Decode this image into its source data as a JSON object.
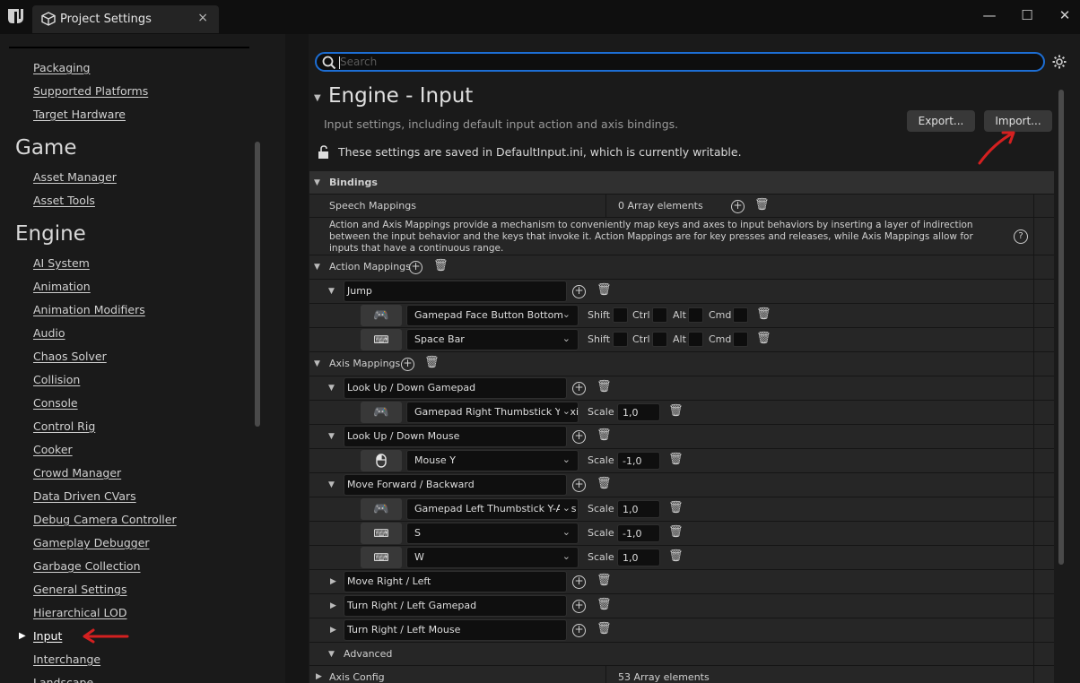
{
  "window": {
    "tab_title": "Project Settings",
    "close": "×",
    "minimize": "—",
    "maximize": "☐",
    "win_close": "✕"
  },
  "sidebar": {
    "items_top": [
      "Packaging",
      "Supported Platforms",
      "Target Hardware"
    ],
    "game_header": "Game",
    "game_items": [
      "Asset Manager",
      "Asset Tools"
    ],
    "engine_header": "Engine",
    "engine_items": [
      "AI System",
      "Animation",
      "Animation Modifiers",
      "Audio",
      "Chaos Solver",
      "Collision",
      "Console",
      "Control Rig",
      "Cooker",
      "Crowd Manager",
      "Data Driven CVars",
      "Debug Camera Controller",
      "Gameplay Debugger",
      "Garbage Collection",
      "General Settings",
      "Hierarchical LOD",
      "Input",
      "Interchange",
      "Landscape"
    ],
    "selected": "Input"
  },
  "search": {
    "placeholder": "Search"
  },
  "header": {
    "title": "Engine - Input",
    "description": "Input settings, including default input action and axis bindings.",
    "export_label": "Export...",
    "import_label": "Import...",
    "writable_note": "These settings are saved in DefaultInput.ini, which is currently writable."
  },
  "bindings": {
    "section": "Bindings",
    "speech_label": "Speech Mappings",
    "speech_count": "0 Array elements",
    "description": "Action and Axis Mappings provide a mechanism to conveniently map keys and axes to input behaviors by inserting a layer of indirection between the input behavior and the keys that invoke it. Action Mappings are for key presses and releases, while Axis Mappings allow for inputs that have a continuous range.",
    "help": "?",
    "action_label": "Action Mappings",
    "jump": "Jump",
    "jump_key1": "Gamepad Face Button Bottom",
    "jump_key2": "Space Bar",
    "mods": {
      "shift": "Shift",
      "ctrl": "Ctrl",
      "alt": "Alt",
      "cmd": "Cmd"
    },
    "axis_label": "Axis Mappings",
    "scale_label": "Scale",
    "axis1": "Look Up / Down Gamepad",
    "axis1_key": "Gamepad Right Thumbstick Y-Axis",
    "axis1_scale": "1,0",
    "axis2": "Look Up / Down Mouse",
    "axis2_key": "Mouse Y",
    "axis2_scale": "-1,0",
    "axis3": "Move Forward / Backward",
    "axis3_key1": "Gamepad Left Thumbstick Y-Axis",
    "axis3_scale1": "1,0",
    "axis3_key2": "S",
    "axis3_scale2": "-1,0",
    "axis3_key3": "W",
    "axis3_scale3": "1,0",
    "axis4": "Move Right / Left",
    "axis5": "Turn Right / Left Gamepad",
    "axis6": "Turn Right / Left Mouse",
    "advanced": "Advanced",
    "axis_config": "Axis Config",
    "axis_config_count": "53 Array elements"
  },
  "colors": {
    "accent": "#1d6ed4",
    "annotation": "#d42020"
  }
}
